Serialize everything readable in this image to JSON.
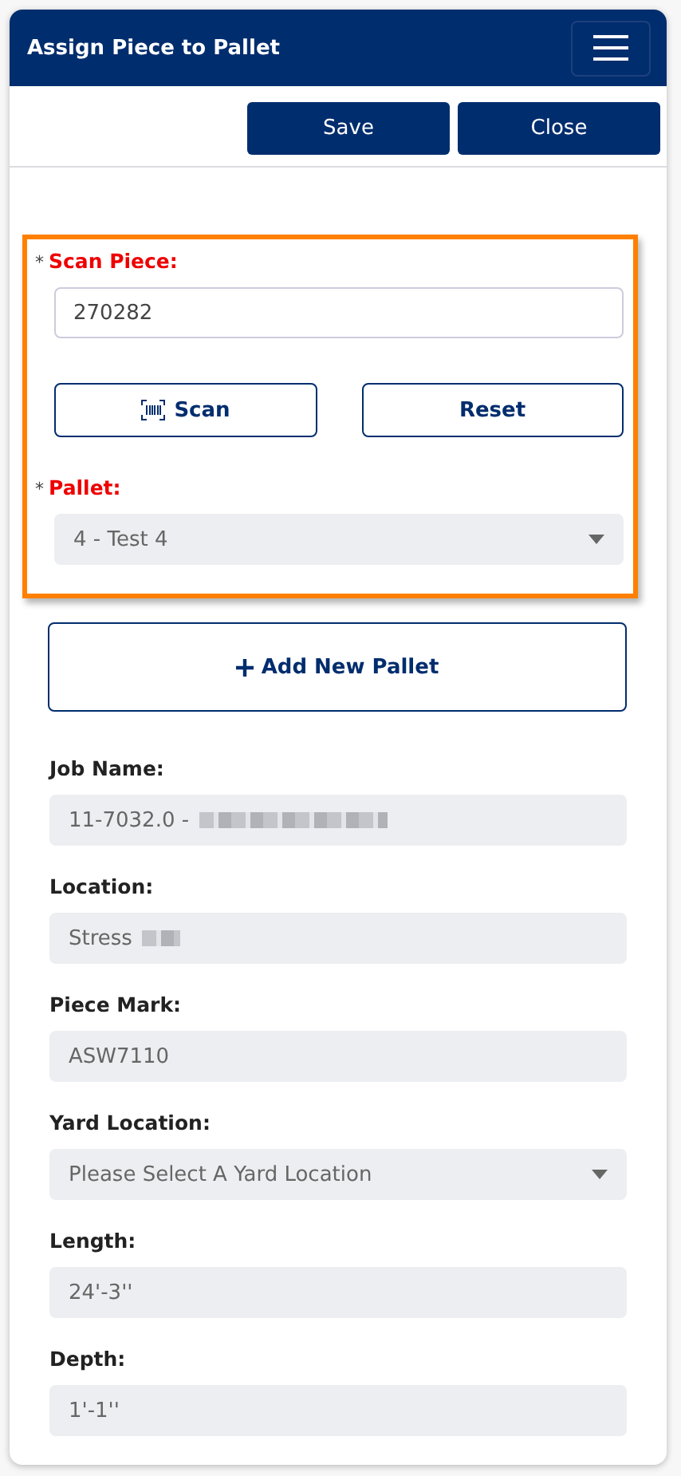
{
  "header": {
    "title": "Assign Piece to Pallet"
  },
  "toolbar": {
    "buttons": [
      "Save",
      "Close"
    ]
  },
  "highlight_section": {
    "fields": [
      {
        "kind": "text",
        "asterisk": "*",
        "label": "Scan Piece:",
        "value": "270282",
        "disabled": false
      },
      {
        "kind": "buttons",
        "buttons": [
          {
            "kind": "scan",
            "label": "Scan"
          },
          {
            "kind": "reset",
            "label": "Reset"
          }
        ]
      },
      {
        "kind": "select",
        "asterisk": "*",
        "label": "Pallet:",
        "value": "4 - Test 4",
        "disabled": true
      }
    ]
  },
  "add_button": {
    "label": "Add New Pallet"
  },
  "fields": [
    {
      "kind": "text",
      "label": "Job Name:",
      "value": "11-7032.0 -",
      "redacted": true,
      "disabled": true
    },
    {
      "kind": "text",
      "label": "Location:",
      "value": "Stress",
      "redacted": true,
      "disabled": true
    },
    {
      "kind": "text",
      "label": "Piece Mark:",
      "value": "ASW7110",
      "redacted": false,
      "disabled": true
    },
    {
      "kind": "select",
      "label": "Yard Location:",
      "placeholder": "Please Select A Yard Location",
      "disabled": true
    },
    {
      "kind": "text",
      "label": "Length:",
      "value": "24'-3''",
      "redacted": false,
      "disabled": true
    },
    {
      "kind": "text",
      "label": "Depth:",
      "value": "1'-1''",
      "redacted": false,
      "disabled": true
    }
  ]
}
